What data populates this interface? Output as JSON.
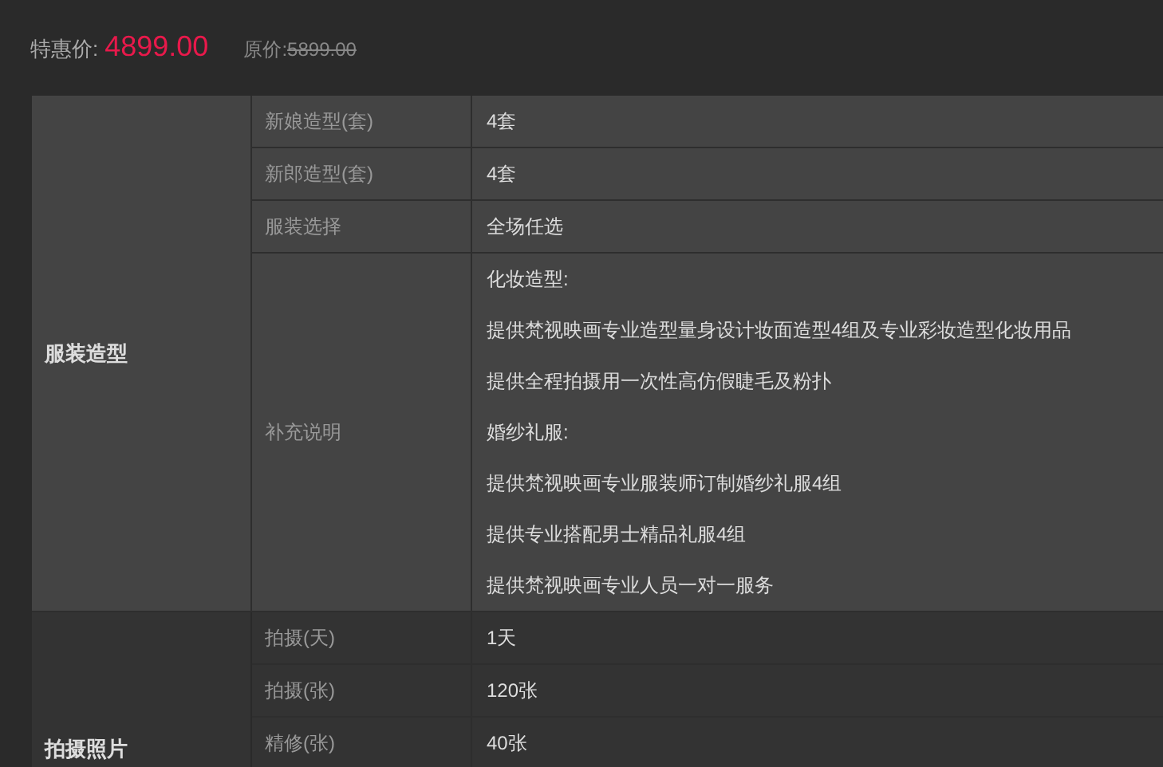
{
  "price": {
    "sale_label": "特惠价:",
    "sale_price": "4899.00",
    "original_label": "原价:",
    "original_price": "5899.00"
  },
  "sections": [
    {
      "title": "服装造型",
      "rows": [
        {
          "label": "新娘造型(套)",
          "lines": [
            "4套"
          ]
        },
        {
          "label": "新郎造型(套)",
          "lines": [
            "4套"
          ]
        },
        {
          "label": "服装选择",
          "lines": [
            "全场任选"
          ]
        },
        {
          "label": "补充说明",
          "lines": [
            "化妆造型:",
            "提供梵视映画专业造型量身设计妆面造型4组及专业彩妆造型化妆用品",
            "提供全程拍摄用一次性高仿假睫毛及粉扑",
            "婚纱礼服:",
            "提供梵视映画专业服装师订制婚纱礼服4组",
            "提供专业搭配男士精品礼服4组",
            "提供梵视映画专业人员一对一服务"
          ]
        }
      ]
    },
    {
      "title": "拍摄照片",
      "rows": [
        {
          "label": "拍摄(天)",
          "lines": [
            "1天"
          ]
        },
        {
          "label": "拍摄(张)",
          "lines": [
            "120张"
          ]
        },
        {
          "label": "精修(张)",
          "lines": [
            "40张"
          ]
        }
      ]
    }
  ]
}
